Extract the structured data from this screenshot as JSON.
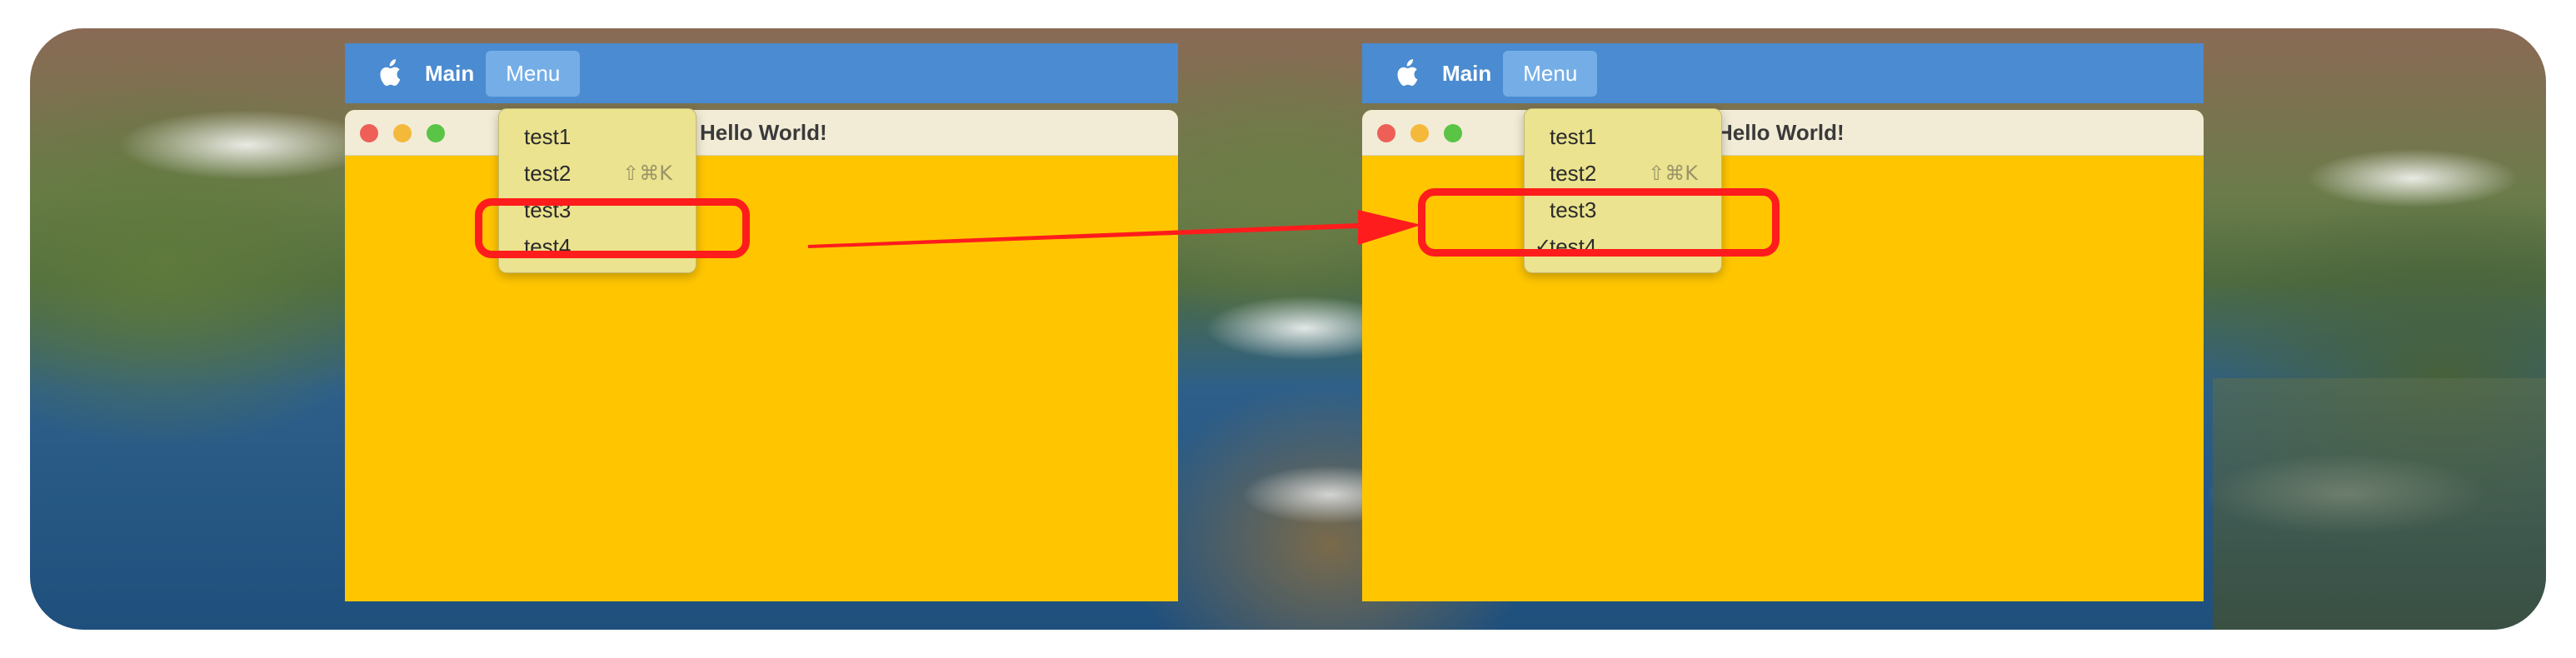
{
  "background": {
    "description_colors": {
      "sky_accent": "#8a6a55",
      "hills": "#5f7a3c",
      "sea": "#2d5f8a"
    }
  },
  "panels": [
    {
      "id": "before",
      "menubar": {
        "app_name": "Main",
        "menu_label": "Menu"
      },
      "window": {
        "title": "Hello World!"
      },
      "dropdown": {
        "items": [
          {
            "label": "test1",
            "shortcut": "",
            "checked": false
          },
          {
            "label": "test2",
            "shortcut": "⇧⌘K",
            "checked": false
          },
          {
            "label": "test3",
            "shortcut": "",
            "checked": false
          },
          {
            "label": "test4",
            "shortcut": "",
            "checked": false
          }
        ]
      }
    },
    {
      "id": "after",
      "menubar": {
        "app_name": "Main",
        "menu_label": "Menu"
      },
      "window": {
        "title": "Hello World!"
      },
      "dropdown": {
        "items": [
          {
            "label": "test1",
            "shortcut": "",
            "checked": false
          },
          {
            "label": "test2",
            "shortcut": "⇧⌘K",
            "checked": false
          },
          {
            "label": "test3",
            "shortcut": "",
            "checked": false
          },
          {
            "label": "test4",
            "shortcut": "",
            "checked": true,
            "check_glyph": "✓"
          }
        ]
      }
    }
  ],
  "colors": {
    "menubar": "#4a8bd1",
    "menu_active": "#75aee6",
    "window_body": "#ffc600",
    "titlebar": "#f2ecd6",
    "dropdown": "#ebe38f",
    "highlight": "#ff1c1c"
  },
  "icons": {
    "apple": "apple-logo-icon",
    "arrow": "right-arrow-annotation"
  }
}
